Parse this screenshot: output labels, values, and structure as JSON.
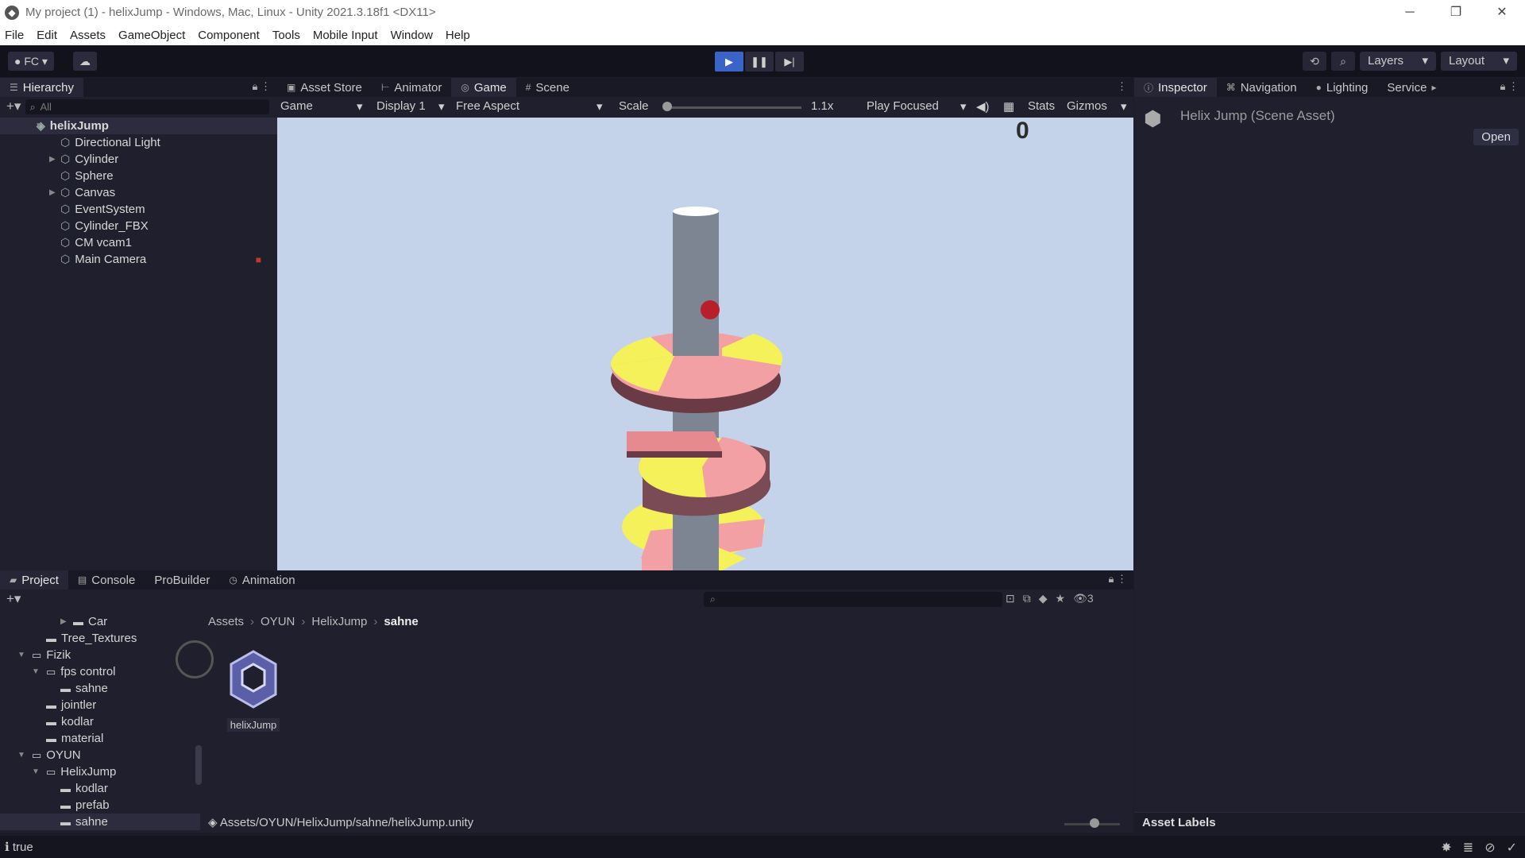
{
  "window": {
    "title": "My project (1) - helixJump - Windows, Mac, Linux - Unity 2021.3.18f1 <DX11>",
    "minimize": "─",
    "restore": "❐",
    "close": "✕"
  },
  "menu": [
    "File",
    "Edit",
    "Assets",
    "GameObject",
    "Component",
    "Tools",
    "Mobile Input",
    "Window",
    "Help"
  ],
  "toolbar": {
    "account": "FC",
    "play_state": "playing",
    "layers": "Layers",
    "layout": "Layout"
  },
  "hierarchy": {
    "tab": "Hierarchy",
    "search_placeholder": "All",
    "root": "helixJump",
    "items": [
      {
        "label": "Directional Light"
      },
      {
        "label": "Cylinder"
      },
      {
        "label": "Sphere"
      },
      {
        "label": "Canvas"
      },
      {
        "label": "EventSystem"
      },
      {
        "label": "Cylinder_FBX"
      },
      {
        "label": "CM vcam1"
      },
      {
        "label": "Main Camera"
      }
    ]
  },
  "center_tabs": [
    "Asset Store",
    "Animator",
    "Game",
    "Scene"
  ],
  "game": {
    "mode": "Game",
    "display": "Display 1",
    "aspect": "Free Aspect",
    "scale_label": "Scale",
    "scale_value": "1.1x",
    "play_mode": "Play Focused",
    "stats": "Stats",
    "gizmos": "Gizmos",
    "score": "0",
    "sky_color": "#c5d3ea"
  },
  "inspector": {
    "tabs": [
      "Inspector",
      "Navigation",
      "Lighting",
      "Service"
    ],
    "title": "Helix Jump (Scene Asset)",
    "open": "Open",
    "asset_labels": "Asset Labels"
  },
  "project": {
    "tabs": [
      "Project",
      "Console",
      "ProBuilder",
      "Animation"
    ],
    "hidden_count": "3",
    "tree": [
      {
        "label": "Car"
      },
      {
        "label": "Tree_Textures"
      },
      {
        "label": "Fizik"
      },
      {
        "label": "fps control"
      },
      {
        "label": "sahne"
      },
      {
        "label": "jointler"
      },
      {
        "label": "kodlar"
      },
      {
        "label": "material"
      },
      {
        "label": "OYUN"
      },
      {
        "label": "HelixJump"
      },
      {
        "label": "kodlar"
      },
      {
        "label": "prefab"
      },
      {
        "label": "sahne"
      }
    ],
    "breadcrumbs": [
      "Assets",
      "OYUN",
      "HelixJump",
      "sahne"
    ],
    "asset": "helixJump",
    "path": "Assets/OYUN/HelixJump/sahne/helixJump.unity"
  },
  "status": {
    "message": "true"
  },
  "colors": {
    "accent": "#3a64c8",
    "platform_pink": "#f2a0a4",
    "platform_yellow": "#f4f15a",
    "ball": "#b81f2a"
  }
}
